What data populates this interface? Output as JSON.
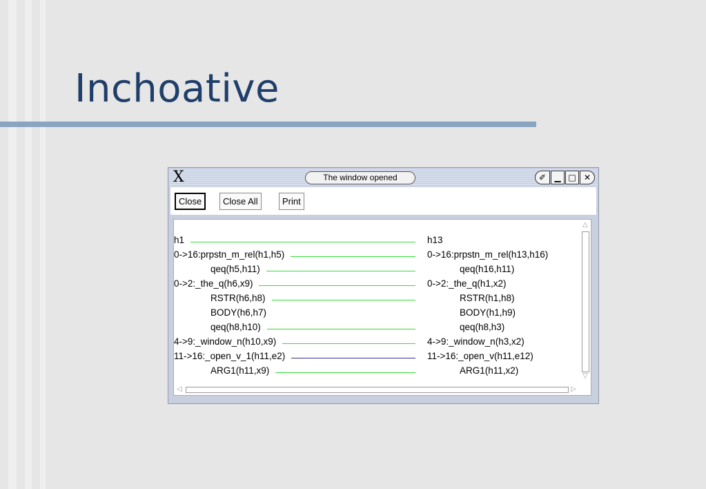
{
  "slide": {
    "title": "Inchoative"
  },
  "window": {
    "title": "The window opened",
    "controls": {
      "pin": "✐",
      "minimize": "▁",
      "maximize": "□",
      "close": "✕"
    },
    "buttons": {
      "close": "Close",
      "close_all": "Close All",
      "print": "Print"
    }
  },
  "mrs_left": [
    "h1",
    "0->16:prpstn_m_rel(h1,h5)",
    "qeq(h5,h11)",
    "0->2:_the_q(h6,x9)",
    "RSTR(h6,h8)",
    "BODY(h6,h7)",
    "qeq(h8,h10)",
    "4->9:_window_n(h10,x9)",
    "11->16:_open_v_1(h11,e2)",
    "ARG1(h11,x9)"
  ],
  "mrs_right": [
    "h13",
    "0->16:prpstn_m_rel(h13,h16)",
    "qeq(h16,h11)",
    "0->2:_the_q(h1,x2)",
    "RSTR(h1,h8)",
    "BODY(h1,h9)",
    "qeq(h8,h3)",
    "4->9:_window_n(h3,x2)",
    "11->16:_open_v(h11,e12)",
    "ARG1(h11,x2)"
  ],
  "link_colors": {
    "match": "#33dd33",
    "mismatch": "#333399"
  },
  "link_status": [
    "match",
    "match",
    "match",
    "match",
    "match",
    "none",
    "match",
    "match",
    "mismatch",
    "match"
  ]
}
